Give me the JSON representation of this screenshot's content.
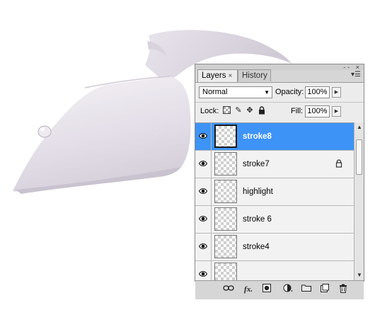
{
  "panel": {
    "tabs": [
      {
        "label": "Layers",
        "close": "×"
      },
      {
        "label": "History"
      }
    ],
    "window_controls": "-- ×",
    "blend_mode": "Normal",
    "opacity_label": "Opacity:",
    "opacity_value": "100%",
    "lock_label": "Lock:",
    "fill_label": "Fill:",
    "fill_value": "100%",
    "layers": [
      {
        "name": "stroke8",
        "selected": true,
        "visible": true,
        "locked": false
      },
      {
        "name": "stroke7",
        "selected": false,
        "visible": true,
        "locked": true
      },
      {
        "name": "highlight",
        "selected": false,
        "visible": true,
        "locked": false
      },
      {
        "name": "stroke 6",
        "selected": false,
        "visible": true,
        "locked": false
      },
      {
        "name": "stroke4",
        "selected": false,
        "visible": true,
        "locked": false
      },
      {
        "name": "",
        "selected": false,
        "visible": true,
        "locked": false
      }
    ],
    "footer_icons": [
      "link-icon",
      "fx-icon",
      "layer-mask-icon",
      "adjustment-layer-icon",
      "group-folder-icon",
      "new-layer-icon",
      "trash-icon"
    ]
  },
  "colors": {
    "selection": "#3d94f6",
    "panel_bg": "#d6d6d6",
    "list_bg": "#f2f2f2",
    "artwork": "#e3dde6"
  }
}
